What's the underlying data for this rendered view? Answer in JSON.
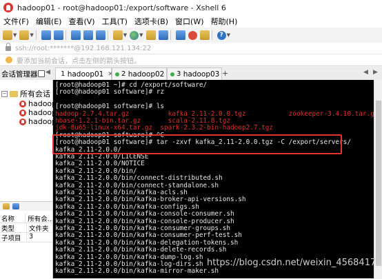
{
  "window": {
    "title": "hadoop01 - root@hadoop01:/export/software - Xshell 6"
  },
  "menu": [
    {
      "label": "文件(F)"
    },
    {
      "label": "编辑(E)"
    },
    {
      "label": "查看(V)"
    },
    {
      "label": "工具(T)"
    },
    {
      "label": "选项卡(B)"
    },
    {
      "label": "窗口(W)"
    },
    {
      "label": "帮助(H)"
    }
  ],
  "address": {
    "text": "ssh://root:*******@192.168.121.134:22"
  },
  "hint": {
    "text": "要添加当前会话，点击左侧的箭头按钮。"
  },
  "session_panel": {
    "title": "会话管理器"
  },
  "tabs": [
    {
      "num": "1",
      "label": "hadoop01"
    },
    {
      "num": "2",
      "label": "hadoop02"
    },
    {
      "num": "3",
      "label": "hadoop03"
    }
  ],
  "tree": {
    "root": "所有会话",
    "items": [
      {
        "label": "hadoop"
      },
      {
        "label": "hadoop"
      },
      {
        "label": "hadoop"
      }
    ]
  },
  "properties": {
    "rows": [
      {
        "key": "名称",
        "value": "所有会..."
      },
      {
        "key": "类型",
        "value": "文件夹"
      },
      {
        "key": "子项目",
        "value": "3"
      }
    ]
  },
  "terminal": {
    "lines": [
      {
        "text": "[root@hadoop01 ~]# cd /export/software/",
        "color": "#e8e8e8"
      },
      {
        "text": "[root@hadoop01 software]# rz",
        "color": "#e8e8e8"
      },
      {
        "text": "",
        "color": "#e8e8e8"
      },
      {
        "text": "[root@hadoop01 software]# ls",
        "color": "#e8e8e8"
      },
      {
        "text": "hadoop-2.7.4.tar.gz          kafka_2.11-2.0.0.tgz           zookeeper-3.4.10.tar.gz",
        "color": "#e0302a"
      },
      {
        "text": "hbase-1.2.1-bin.tar.gz       scala-2.11.8.tgz",
        "color": "#e0302a"
      },
      {
        "text": "jdk-8u65-linux-x64.tar.gz  spark-2.3.2-bin-hadoop2.7.tgz",
        "color": "#e0302a"
      },
      {
        "text": "[root@hadoop01 software]# ^C",
        "color": "#e8e8e8"
      },
      {
        "text": "[root@hadoop01 software]# tar -zxvf kafka_2.11-2.0.0.tgz -C /export/servers/",
        "color": "#e8e8e8"
      },
      {
        "text": "kafka_2.11-2.0.0/",
        "color": "#e8e8e8"
      },
      {
        "text": "kafka_2.11-2.0.0/LICENSE",
        "color": "#e8e8e8"
      },
      {
        "text": "kafka_2.11-2.0.0/NOTICE",
        "color": "#e8e8e8"
      },
      {
        "text": "kafka_2.11-2.0.0/bin/",
        "color": "#e8e8e8"
      },
      {
        "text": "kafka_2.11-2.0.0/bin/connect-distributed.sh",
        "color": "#e8e8e8"
      },
      {
        "text": "kafka_2.11-2.0.0/bin/connect-standalone.sh",
        "color": "#e8e8e8"
      },
      {
        "text": "kafka_2.11-2.0.0/bin/kafka-acls.sh",
        "color": "#e8e8e8"
      },
      {
        "text": "kafka_2.11-2.0.0/bin/kafka-broker-api-versions.sh",
        "color": "#e8e8e8"
      },
      {
        "text": "kafka_2.11-2.0.0/bin/kafka-configs.sh",
        "color": "#e8e8e8"
      },
      {
        "text": "kafka_2.11-2.0.0/bin/kafka-console-consumer.sh",
        "color": "#e8e8e8"
      },
      {
        "text": "kafka_2.11-2.0.0/bin/kafka-console-producer.sh",
        "color": "#e8e8e8"
      },
      {
        "text": "kafka_2.11-2.0.0/bin/kafka-consumer-groups.sh",
        "color": "#e8e8e8"
      },
      {
        "text": "kafka_2.11-2.0.0/bin/kafka-consumer-perf-test.sh",
        "color": "#e8e8e8"
      },
      {
        "text": "kafka_2.11-2.0.0/bin/kafka-delegation-tokens.sh",
        "color": "#e8e8e8"
      },
      {
        "text": "kafka_2.11-2.0.0/bin/kafka-delete-records.sh",
        "color": "#e8e8e8"
      },
      {
        "text": "kafka_2.11-2.0.0/bin/kafka-dump-log.sh",
        "color": "#e8e8e8"
      },
      {
        "text": "kafka_2.11-2.0.0/bin/kafka-log-dirs.sh",
        "color": "#e8e8e8"
      },
      {
        "text": "kafka_2.11-2.0.0/bin/kafka-mirror-maker.sh",
        "color": "#e8e8e8"
      }
    ]
  },
  "watermark": "https://blog.csdn.net/weixin_45684171",
  "colors": {
    "highlight_box": "#e2332c",
    "terminal_bg": "#000000",
    "status_dot": "#3fae49"
  },
  "icons": [
    "xshell-app-icon",
    "new-session-icon",
    "open-folder-icon",
    "globe-icon",
    "red-circle-icon",
    "help-icon",
    "lock-icon",
    "hint-bulb-icon",
    "folder-icon",
    "session-icon"
  ]
}
